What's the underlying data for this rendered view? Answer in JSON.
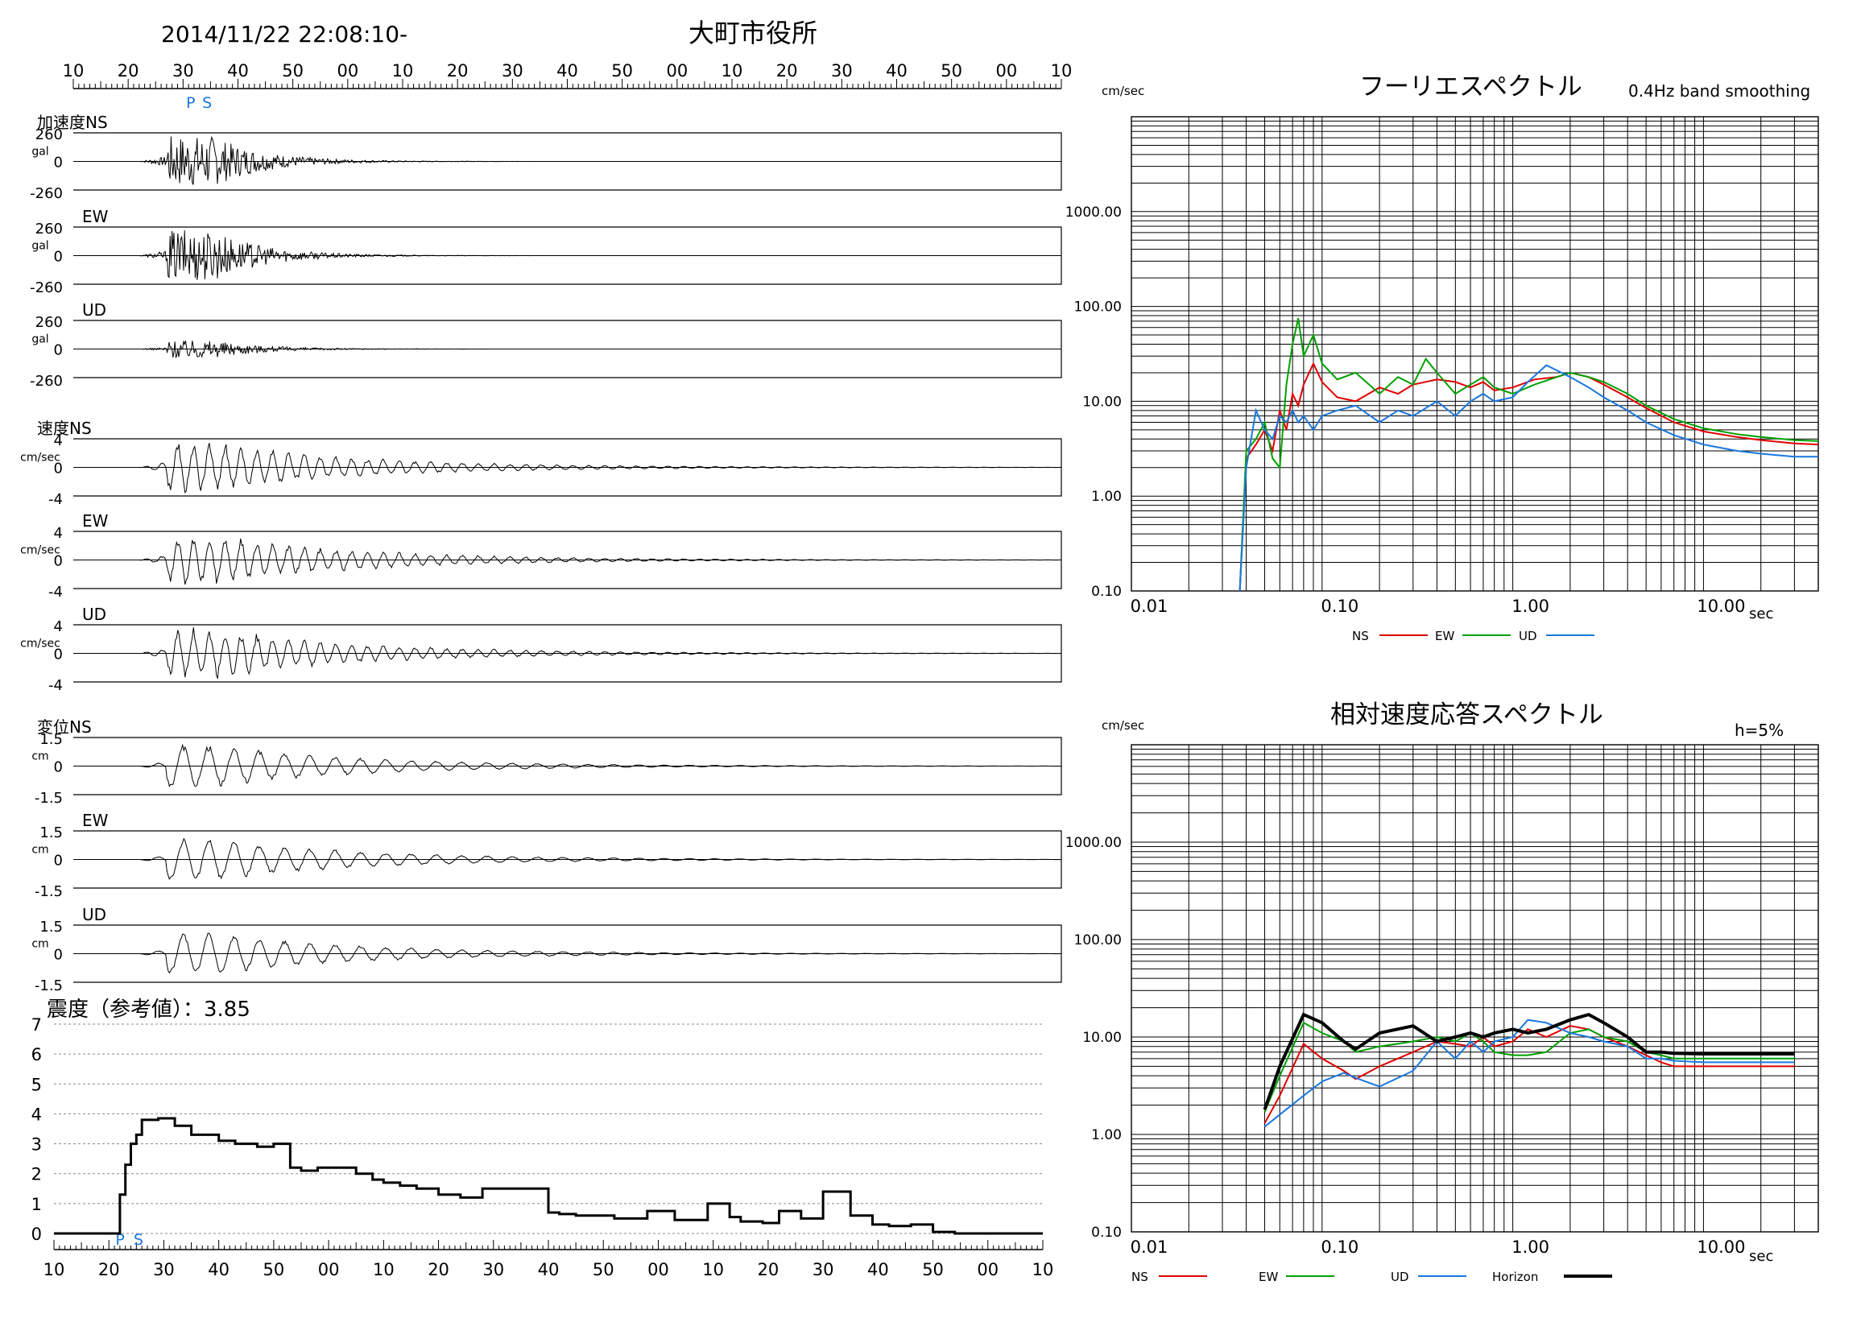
{
  "header": {
    "datetime": "2014/11/22 22:08:10-",
    "station": "大町市役所"
  },
  "time_axis": {
    "tick_labels": [
      "10",
      "20",
      "30",
      "40",
      "50",
      "00",
      "10",
      "20",
      "30",
      "40",
      "50",
      "00",
      "10",
      "20",
      "30",
      "40",
      "50",
      "00",
      "10"
    ],
    "p_label": "P",
    "s_label": "S"
  },
  "waveforms": [
    {
      "group": "加速度",
      "label": "加速度NS",
      "unit": "gal",
      "max_label": "260",
      "zero_label": "0",
      "min_label": "-260"
    },
    {
      "group": "加速度",
      "label": "EW",
      "unit": "gal",
      "max_label": "260",
      "zero_label": "0",
      "min_label": "-260"
    },
    {
      "group": "加速度",
      "label": "UD",
      "unit": "gal",
      "max_label": "260",
      "zero_label": "0",
      "min_label": "-260"
    },
    {
      "group": "速度",
      "label": "速度NS",
      "unit": "cm/sec",
      "max_label": "4",
      "zero_label": "0",
      "min_label": "-4"
    },
    {
      "group": "速度",
      "label": "EW",
      "unit": "cm/sec",
      "max_label": "4",
      "zero_label": "0",
      "min_label": "-4"
    },
    {
      "group": "速度",
      "label": "UD",
      "unit": "cm/sec",
      "max_label": "4",
      "zero_label": "0",
      "min_label": "-4"
    },
    {
      "group": "変位",
      "label": "変位NS",
      "unit": "cm",
      "max_label": "1.5",
      "zero_label": "0",
      "min_label": "-1.5"
    },
    {
      "group": "変位",
      "label": "EW",
      "unit": "cm",
      "max_label": "1.5",
      "zero_label": "0",
      "min_label": "-1.5"
    },
    {
      "group": "変位",
      "label": "UD",
      "unit": "cm",
      "max_label": "1.5",
      "zero_label": "0",
      "min_label": "-1.5"
    }
  ],
  "chart_data": [
    {
      "type": "line",
      "title": "震度（参考値）：3.85",
      "ylim": [
        0,
        7
      ],
      "y_tick_labels": [
        "0",
        "1",
        "2",
        "3",
        "4",
        "5",
        "6",
        "7"
      ],
      "x_tick_labels": [
        "10",
        "20",
        "30",
        "40",
        "50",
        "00",
        "10",
        "20",
        "30",
        "40",
        "50",
        "00",
        "10",
        "20",
        "30",
        "40",
        "50",
        "00",
        "10"
      ],
      "xlim_seconds": [
        10,
        190
      ],
      "p_label": "P",
      "s_label": "S",
      "series": [
        {
          "color": "#000000",
          "x": [
            10,
            21,
            22,
            23,
            24,
            25,
            26,
            27,
            29,
            32,
            35,
            37,
            40,
            43,
            47,
            50,
            53,
            55,
            58,
            61,
            65,
            68,
            70,
            73,
            76,
            80,
            84,
            88,
            90,
            95,
            100,
            102,
            105,
            108,
            112,
            116,
            118,
            123,
            126,
            129,
            133,
            135,
            137,
            139,
            142,
            146,
            149,
            150,
            152,
            155,
            159,
            162,
            166,
            170,
            174,
            176,
            180,
            182,
            188,
            190
          ],
          "y": [
            0,
            0,
            1.3,
            2.3,
            3.0,
            3.3,
            3.8,
            3.8,
            3.85,
            3.6,
            3.3,
            3.3,
            3.1,
            3.0,
            2.9,
            3.0,
            2.2,
            2.1,
            2.2,
            2.2,
            2.0,
            1.8,
            1.7,
            1.6,
            1.5,
            1.3,
            1.2,
            1.5,
            1.5,
            1.5,
            0.7,
            0.65,
            0.6,
            0.6,
            0.5,
            0.5,
            0.75,
            0.45,
            0.45,
            1.0,
            0.55,
            0.4,
            0.4,
            0.35,
            0.75,
            0.5,
            0.5,
            1.4,
            1.4,
            0.6,
            0.3,
            0.25,
            0.3,
            0.05,
            0,
            0,
            0,
            0,
            0,
            0
          ]
        }
      ]
    },
    {
      "type": "line",
      "title": "フーリエスペクトル",
      "subtitle": "0.4Hz band smoothing",
      "ylabel": "cm/sec",
      "xlabel": "sec",
      "x_scale": "log",
      "y_scale": "log",
      "xlim": [
        0.01,
        40
      ],
      "ylim": [
        0.1,
        10000
      ],
      "x_tick_labels": [
        "0.01",
        "0.10",
        "1.00",
        "10.00"
      ],
      "y_tick_labels": [
        "0.10",
        "1.00",
        "10.00",
        "100.00",
        "1000.00"
      ],
      "legend_position": "bottom",
      "series": [
        {
          "name": "NS",
          "color": "#e00000",
          "x": [
            0.037,
            0.04,
            0.045,
            0.05,
            0.055,
            0.06,
            0.065,
            0.07,
            0.075,
            0.08,
            0.09,
            0.1,
            0.12,
            0.15,
            0.2,
            0.25,
            0.3,
            0.4,
            0.5,
            0.6,
            0.7,
            0.8,
            1.0,
            1.3,
            1.7,
            2.0,
            2.5,
            3,
            4,
            5,
            7,
            10,
            15,
            20,
            30,
            40
          ],
          "y": [
            0.1,
            2.5,
            3.5,
            5,
            3,
            8,
            5,
            12,
            9,
            15,
            25,
            16,
            11,
            10,
            14,
            12,
            15,
            17,
            16,
            14,
            16,
            13,
            14,
            17,
            18,
            20,
            18,
            15,
            11,
            8.5,
            6,
            4.8,
            4.2,
            3.9,
            3.6,
            3.5
          ]
        },
        {
          "name": "EW",
          "color": "#00a000",
          "x": [
            0.037,
            0.04,
            0.045,
            0.05,
            0.055,
            0.06,
            0.065,
            0.07,
            0.075,
            0.08,
            0.09,
            0.1,
            0.12,
            0.15,
            0.2,
            0.25,
            0.3,
            0.35,
            0.4,
            0.5,
            0.6,
            0.7,
            0.8,
            1.0,
            1.3,
            1.7,
            2.0,
            2.5,
            3,
            4,
            5,
            7,
            10,
            15,
            20,
            30,
            40
          ],
          "y": [
            0.1,
            3,
            4,
            6,
            2.5,
            2,
            15,
            40,
            75,
            30,
            50,
            25,
            17,
            20,
            12,
            18,
            15,
            28,
            20,
            12,
            15,
            18,
            14,
            12,
            15,
            18,
            20,
            18,
            16,
            12,
            9,
            6.5,
            5.2,
            4.5,
            4.2,
            3.9,
            3.8
          ]
        },
        {
          "name": "UD",
          "color": "#1a78e0",
          "x": [
            0.037,
            0.04,
            0.045,
            0.05,
            0.055,
            0.06,
            0.065,
            0.07,
            0.075,
            0.08,
            0.09,
            0.1,
            0.12,
            0.15,
            0.2,
            0.25,
            0.3,
            0.4,
            0.5,
            0.6,
            0.7,
            0.8,
            1.0,
            1.2,
            1.5,
            1.8,
            2.0,
            2.5,
            3,
            4,
            5,
            7,
            10,
            15,
            20,
            30,
            40
          ],
          "y": [
            0.1,
            2,
            8,
            5,
            4,
            7,
            6,
            8,
            6,
            7,
            5,
            7,
            8,
            9,
            6,
            8,
            7,
            10,
            7,
            10,
            12,
            10,
            11,
            16,
            24,
            20,
            18,
            14,
            11,
            8,
            6,
            4.4,
            3.5,
            3.0,
            2.8,
            2.6,
            2.6
          ]
        }
      ]
    },
    {
      "type": "line",
      "title": "相対速度応答スペクトル",
      "subtitle": "h=5%",
      "ylabel": "cm/sec",
      "xlabel": "sec",
      "x_scale": "log",
      "y_scale": "log",
      "xlim": [
        0.01,
        40
      ],
      "ylim": [
        0.1,
        10000
      ],
      "x_tick_labels": [
        "0.01",
        "0.10",
        "1.00",
        "10.00"
      ],
      "y_tick_labels": [
        "0.10",
        "1.00",
        "10.00",
        "100.00",
        "1000.00"
      ],
      "legend_position": "bottom",
      "series": [
        {
          "name": "NS",
          "color": "#e00000",
          "x": [
            0.05,
            0.06,
            0.08,
            0.1,
            0.13,
            0.15,
            0.2,
            0.3,
            0.4,
            0.5,
            0.6,
            0.7,
            0.8,
            1.0,
            1.2,
            1.5,
            2.0,
            2.5,
            3,
            4,
            5,
            6,
            7,
            10,
            15,
            20,
            30
          ],
          "y": [
            1.3,
            2.5,
            8.5,
            6,
            4.5,
            3.7,
            5,
            7,
            9,
            8.5,
            8,
            10,
            8,
            9,
            12,
            10,
            13,
            12,
            10,
            8,
            6.5,
            5.5,
            5,
            5,
            5,
            5,
            5
          ]
        },
        {
          "name": "EW",
          "color": "#00a000",
          "x": [
            0.05,
            0.06,
            0.08,
            0.1,
            0.13,
            0.15,
            0.2,
            0.3,
            0.4,
            0.5,
            0.6,
            0.7,
            0.8,
            1.0,
            1.2,
            1.5,
            2.0,
            2.5,
            3,
            4,
            5,
            6,
            7,
            10,
            15,
            20,
            30
          ],
          "y": [
            1.7,
            4,
            14,
            11,
            9,
            7,
            8,
            9,
            10,
            9,
            11,
            9,
            7,
            6.5,
            6.5,
            7,
            11,
            12,
            10,
            9,
            7,
            6.5,
            6,
            6,
            6,
            6,
            6
          ]
        },
        {
          "name": "UD",
          "color": "#1a78e0",
          "x": [
            0.05,
            0.06,
            0.08,
            0.1,
            0.13,
            0.15,
            0.2,
            0.3,
            0.4,
            0.5,
            0.6,
            0.7,
            0.8,
            1.0,
            1.2,
            1.5,
            2.0,
            2.5,
            3,
            4,
            5,
            6,
            7,
            10,
            15,
            20,
            30
          ],
          "y": [
            1.2,
            1.6,
            2.5,
            3.5,
            4.3,
            3.8,
            3.1,
            4.5,
            9,
            6,
            9,
            7,
            9,
            10,
            15,
            14,
            11,
            10,
            9,
            8,
            6,
            6,
            5.7,
            5.5,
            5.5,
            5.5,
            5.5
          ]
        },
        {
          "name": "Horizon",
          "color": "#000000",
          "x": [
            0.05,
            0.06,
            0.08,
            0.1,
            0.13,
            0.15,
            0.2,
            0.3,
            0.4,
            0.5,
            0.6,
            0.7,
            0.8,
            1.0,
            1.2,
            1.5,
            2.0,
            2.5,
            3,
            4,
            5,
            6,
            7,
            10,
            15,
            20,
            30
          ],
          "y": [
            1.8,
            5,
            17,
            14,
            9,
            7.5,
            11,
            13,
            9,
            10,
            11,
            10,
            11,
            12,
            11,
            12,
            15,
            17,
            14,
            10,
            7,
            7,
            6.8,
            6.7,
            6.7,
            6.7,
            6.7
          ]
        }
      ]
    }
  ]
}
